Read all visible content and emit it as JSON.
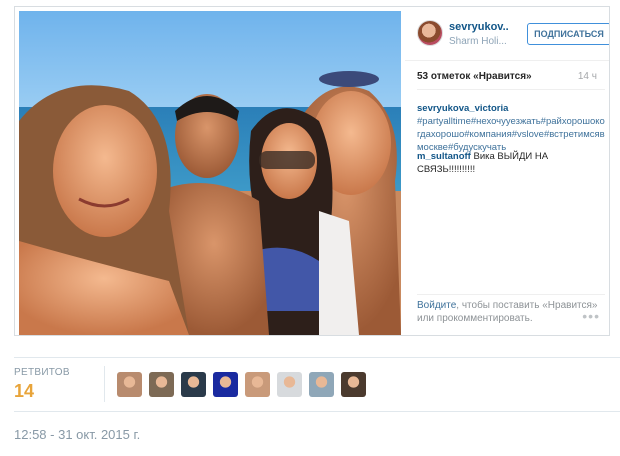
{
  "embed": {
    "username": "sevryukov...",
    "location": "Sharm Holi...",
    "follow_label": "ПОДПИСАТЬСЯ",
    "likes_text": "53 отметок «Нравится»",
    "time_ago": "14 ч",
    "caption": {
      "user": "sevryukova_victoria",
      "tags": "#partyalltime#нехочууезжать#райхорошокогдахорошо#компания#vslove#встретимсявмоскве#будускучать"
    },
    "comment": {
      "user": "m_sultanoff",
      "text": " Вика ВЫЙДИ НА СВЯЗЬ!!!!!!!!!!"
    },
    "login_prompt": {
      "link": "Войдите",
      "text": ", чтобы поставить «Нравится» или прокомментировать."
    },
    "more_icon": "ellipsis-icon"
  },
  "retweets": {
    "label": "РЕТВИТОВ",
    "count": "14",
    "avatars": [
      {
        "name": "retweeter-1",
        "color": "#b88b6e"
      },
      {
        "name": "retweeter-2",
        "color": "#7d6a55"
      },
      {
        "name": "retweeter-3",
        "color": "#2a3a4a"
      },
      {
        "name": "retweeter-4",
        "color": "#1a2aa0"
      },
      {
        "name": "retweeter-5",
        "color": "#c99a7a"
      },
      {
        "name": "retweeter-6",
        "color": "#d7dadd"
      },
      {
        "name": "retweeter-7",
        "color": "#8fa7b8"
      },
      {
        "name": "retweeter-8",
        "color": "#4b3a2e"
      }
    ]
  },
  "timestamp": "12:58 - 31 окт. 2015 г."
}
